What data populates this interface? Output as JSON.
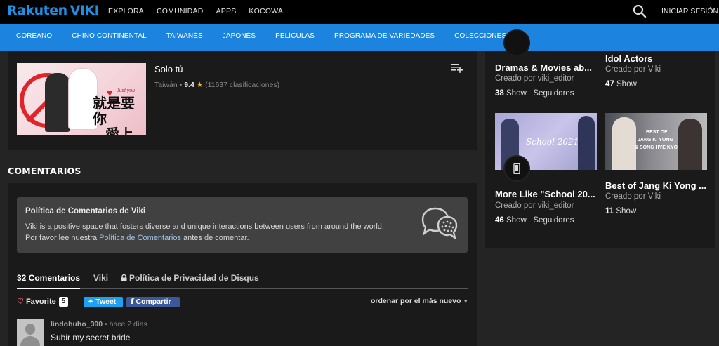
{
  "brand": {
    "logo_main": "Rakuten",
    "logo_sub": "VIKI"
  },
  "topnav": [
    "EXPLORA",
    "COMUNIDAD",
    "APPS",
    "KOCOWA"
  ],
  "signin": "INICIAR SESIÓN",
  "catnav": [
    "COREANO",
    "CHINO CONTINENTAL",
    "TAIWANÉS",
    "JAPONÉS",
    "PELÍCULAS",
    "PROGRAMA DE VARIEDADES",
    "COLECCIONES"
  ],
  "show": {
    "title": "Solo tú",
    "country": "Taiwán",
    "rating": "9.4",
    "ratings_count": "(11637 clasificaciones)",
    "poster_text_1": "就是要你",
    "poster_text_2": "愛上我",
    "poster_small": "Just you"
  },
  "comments": {
    "section_title": "COMENTARIOS",
    "policy_title": "Política de Comentarios de Viki",
    "policy_line1": "Viki is a positive space that fosters diverse and unique interactions between users from around the world.",
    "policy_line2_pre": "Por favor lee nuestra ",
    "policy_link": "Política de Comentarios",
    "policy_line2_post": " antes de comentar.",
    "tab_count": "32 Comentarios",
    "tab_viki": "Viki",
    "tab_privacy": "Política de Privacidad de Disqus",
    "favorite": "Favorite",
    "favorite_count": "5",
    "tweet": "Tweet",
    "share": "Compartir",
    "sort": "ordenar por el más nuevo",
    "first_author": "lindobuho_390",
    "first_time": "hace 2 días",
    "first_text": "Subir my secret bride"
  },
  "collections": [
    {
      "title": "Dramas & Movies ab...",
      "by": "Creado por viki_editor",
      "shows": "38",
      "shows_label": "Show",
      "followers_label": "Seguidores"
    },
    {
      "title": "Idol Actors",
      "by": "Creado por Viki",
      "shows": "47",
      "shows_label": "Show"
    },
    {
      "title": "More Like \"School 20...",
      "by": "Creado por viki_editor",
      "shows": "46",
      "shows_label": "Show",
      "followers_label": "Seguidores",
      "thumb_text": "School 2021"
    },
    {
      "title": "Best of Jang Ki Yong ...",
      "by": "Creado por Viki",
      "shows": "11",
      "shows_label": "Show",
      "thumb_text_1": "BEST OF",
      "thumb_text_2": "JANG KI YONG",
      "thumb_text_3": "& SONG HYE KYO"
    }
  ],
  "colors": {
    "accent": "#1c84de",
    "bg": "#242424",
    "panel": "#1a1a1a",
    "tweet": "#1da1f2",
    "facebook": "#3b5998"
  }
}
